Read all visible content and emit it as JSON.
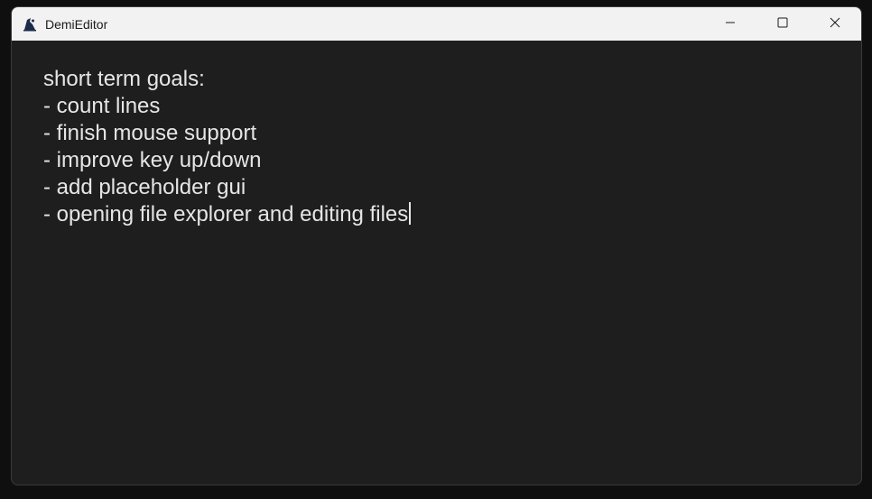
{
  "window": {
    "title": "DemiEditor",
    "app_icon": "wizard-hat-icon",
    "controls": {
      "minimize_icon": "minimize-icon",
      "maximize_icon": "maximize-icon",
      "close_icon": "close-icon"
    }
  },
  "editor": {
    "lines": [
      "short term goals:",
      "- count lines",
      "- finish mouse support",
      "- improve key up/down",
      "- add placeholder gui",
      "- opening file explorer and editing files"
    ],
    "text_color": "#e6e6e6",
    "background": "#1e1e1e"
  }
}
